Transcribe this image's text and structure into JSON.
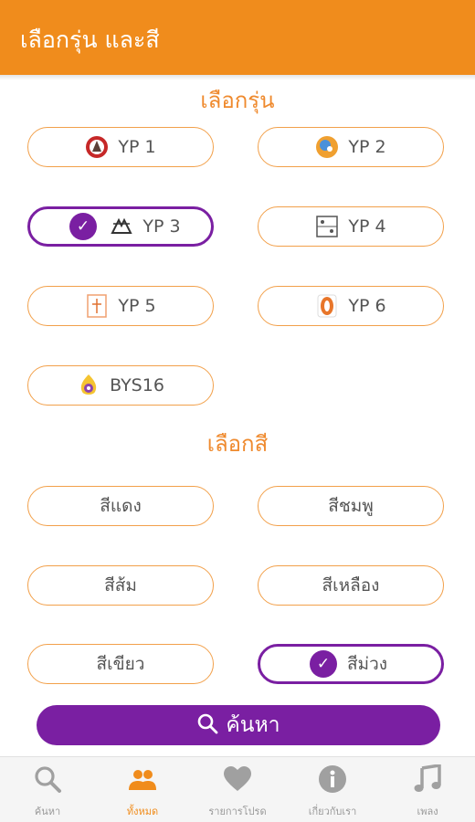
{
  "header": {
    "title": "เลือกรุ่น และสี"
  },
  "model_section": {
    "title": "เลือกรุ่น"
  },
  "models": [
    {
      "label": "YP 1",
      "logo": "red-crest-icon",
      "selected": false
    },
    {
      "label": "YP 2",
      "logo": "blue-orange-emblem-icon",
      "selected": false
    },
    {
      "label": "YP 3",
      "logo": "black-crest-icon",
      "selected": true
    },
    {
      "label": "YP 4",
      "logo": "yp4-box-logo-icon",
      "selected": false
    },
    {
      "label": "YP 5",
      "logo": "orange-crest-icon",
      "selected": false
    },
    {
      "label": "YP 6",
      "logo": "orange-emblem-icon",
      "selected": false
    },
    {
      "label": "BYS16",
      "logo": "yellow-purple-badge-icon",
      "selected": false
    }
  ],
  "color_section": {
    "title": "เลือกสี"
  },
  "colors": [
    {
      "label": "สีแดง",
      "selected": false
    },
    {
      "label": "สีชมพู",
      "selected": false
    },
    {
      "label": "สีส้ม",
      "selected": false
    },
    {
      "label": "สีเหลือง",
      "selected": false
    },
    {
      "label": "สีเขียว",
      "selected": false
    },
    {
      "label": "สีม่วง",
      "selected": true
    }
  ],
  "search_button": {
    "label": "ค้นหา",
    "icon": "search-icon"
  },
  "bottom_nav": [
    {
      "label": "ค้นหา",
      "icon": "search-icon",
      "active": false
    },
    {
      "label": "ทั้งหมด",
      "icon": "people-icon",
      "active": true
    },
    {
      "label": "รายการโปรด",
      "icon": "heart-icon",
      "active": false
    },
    {
      "label": "เกี่ยวกับเรา",
      "icon": "info-icon",
      "active": false
    },
    {
      "label": "เพลง",
      "icon": "music-note-icon",
      "active": false
    }
  ],
  "theme": {
    "primary": "#f08c1c",
    "accent": "#7a1fa2",
    "border": "#f2a04a"
  }
}
